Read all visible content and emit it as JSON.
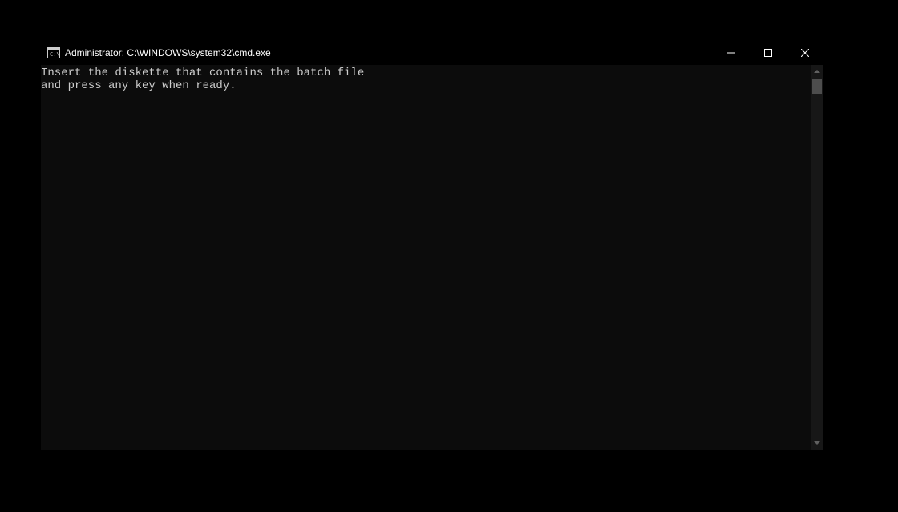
{
  "window": {
    "title": "Administrator: C:\\WINDOWS\\system32\\cmd.exe"
  },
  "console": {
    "lines": [
      "Insert the diskette that contains the batch file",
      "and press any key when ready."
    ]
  }
}
